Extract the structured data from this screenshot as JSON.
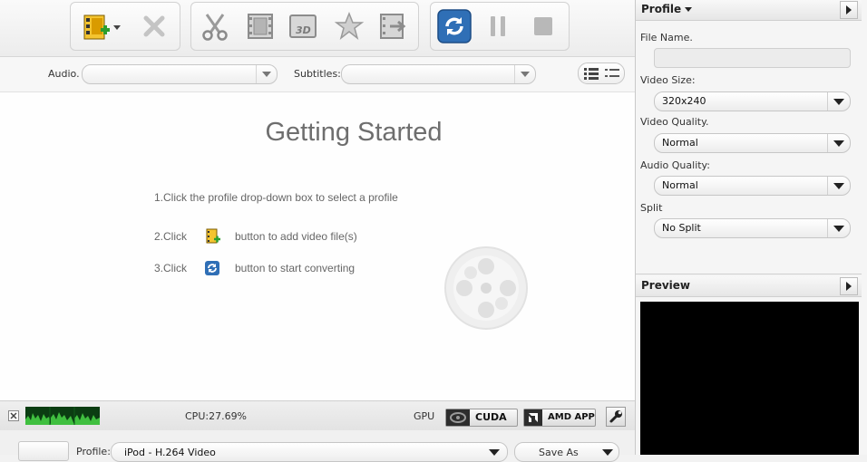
{
  "toolbar": {
    "add_video": "add-video-icon",
    "remove": "remove-icon",
    "trim": "trim-icon",
    "crop": "crop-icon",
    "effect_3d": "3d-icon",
    "effect": "effect-icon",
    "watermark": "watermark-icon",
    "convert": "convert-icon",
    "pause": "pause-icon",
    "stop": "stop-icon"
  },
  "filters": {
    "audio_label": "Audio.",
    "audio_value": "",
    "subtitles_label": "Subtitles:",
    "subtitles_value": ""
  },
  "getting_started": {
    "title": "Getting Started",
    "step1": "1.Click  the profile drop-down box to select a profile",
    "step2_prefix": "2.Click",
    "step2_suffix": "button to add video file(s)",
    "step3_prefix": "3.Click",
    "step3_suffix": "button to start converting"
  },
  "status": {
    "cpu": "CPU:27.69%",
    "gpu_label": "GPU",
    "cuda": "CUDA",
    "amd": "AMD APP"
  },
  "bottom": {
    "profile_label": "Profile:",
    "profile_value": "iPod - H.264 Video",
    "save_as": "Save As"
  },
  "right_panel": {
    "profile_header": "Profile",
    "file_name_label": "File Name.",
    "file_name_value": "",
    "video_size_label": "Video Size:",
    "video_size_value": "320x240",
    "video_quality_label": "Video Quality.",
    "video_quality_value": "Normal",
    "audio_quality_label": "Audio Quality:",
    "audio_quality_value": "Normal",
    "split_label": "Split",
    "split_value": "No Split",
    "preview_header": "Preview"
  },
  "colors": {
    "accent_blue": "#2f6fb6",
    "preview_bg": "#000000"
  }
}
